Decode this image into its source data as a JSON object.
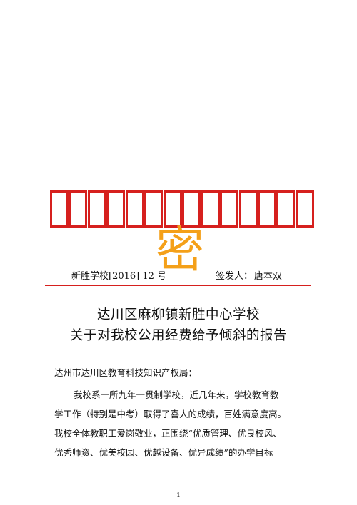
{
  "header": {
    "title_glyph_count": 14,
    "title_color": "#d6201e",
    "secret_mark": "密",
    "secret_color": "#f4a019"
  },
  "meta": {
    "doc_number": "新胜学校[2016] 12 号",
    "issuer_label": "签发人：",
    "issuer_name": "唐本双"
  },
  "title": {
    "line1": "达川区麻柳镇新胜中心学校",
    "line2": "关于对我校公用经费给予倾斜的报告"
  },
  "body": {
    "addressee": "达州市达川区教育科技知识产权局：",
    "lines": [
      "我校系一所九年一贯制学校，近几年来，学校教育教",
      "学工作（特别是中考）取得了喜人的成绩，百姓满意度高。",
      "我校全体教职工爱岗敬业，正围绕“优质管理、优良校风、",
      "优秀师资、优美校园、优越设备、优异成绩”的办学目标"
    ]
  },
  "footer": {
    "page_number": "1"
  }
}
